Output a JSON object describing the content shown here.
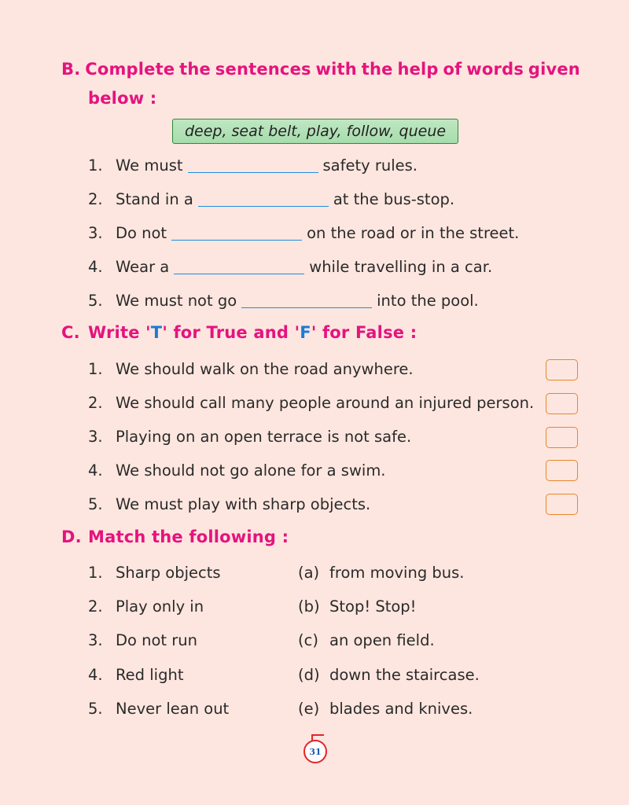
{
  "section_b": {
    "letter": "B.",
    "title_line1": [
      "Complete",
      "the",
      "sentences",
      "with",
      "the",
      "help",
      "of",
      "words",
      "given"
    ],
    "title_line2": "below :",
    "word_box": "deep, seat belt, play, follow, queue",
    "items": [
      {
        "num": "1.",
        "before": "We must",
        "after": "safety rules."
      },
      {
        "num": "2.",
        "before": "Stand in a",
        "after": "at the bus-stop."
      },
      {
        "num": "3.",
        "before": "Do not",
        "after": "on the road or in the street."
      },
      {
        "num": "4.",
        "before": "Wear a",
        "after": "while travelling in a car."
      },
      {
        "num": "5.",
        "before": "We must not go",
        "after": "into the pool."
      }
    ]
  },
  "section_c": {
    "letter": "C.",
    "title_part1": "Write '",
    "title_t": "T",
    "title_part2": "' for True and '",
    "title_f": "F",
    "title_part3": "' for False :",
    "items": [
      {
        "num": "1.",
        "text": "We should walk on the road anywhere."
      },
      {
        "num": "2.",
        "text": "We should call many people around an injured person."
      },
      {
        "num": "3.",
        "text": "Playing on an open terrace is not safe."
      },
      {
        "num": "4.",
        "text": "We should not go alone for a swim."
      },
      {
        "num": "5.",
        "text": "We must play with sharp objects."
      }
    ]
  },
  "section_d": {
    "letter": "D.",
    "title": "Match the following :",
    "left": [
      {
        "num": "1.",
        "text": "Sharp objects"
      },
      {
        "num": "2.",
        "text": "Play only in"
      },
      {
        "num": "3.",
        "text": "Do not run"
      },
      {
        "num": "4.",
        "text": "Red light"
      },
      {
        "num": "5.",
        "text": "Never lean out"
      }
    ],
    "right": [
      {
        "label": "(a)",
        "text": "from moving bus."
      },
      {
        "label": "(b)",
        "text": "Stop! Stop!"
      },
      {
        "label": "(c)",
        "text": "an open field."
      },
      {
        "label": "(d)",
        "text": "down the staircase."
      },
      {
        "label": "(e)",
        "text": "blades and knives."
      }
    ]
  },
  "page_number": "31",
  "colors": {
    "heading": "#e5137e",
    "accent_blue": "#1a7bd8",
    "background": "#fde6df",
    "box_border": "#e8862a"
  }
}
